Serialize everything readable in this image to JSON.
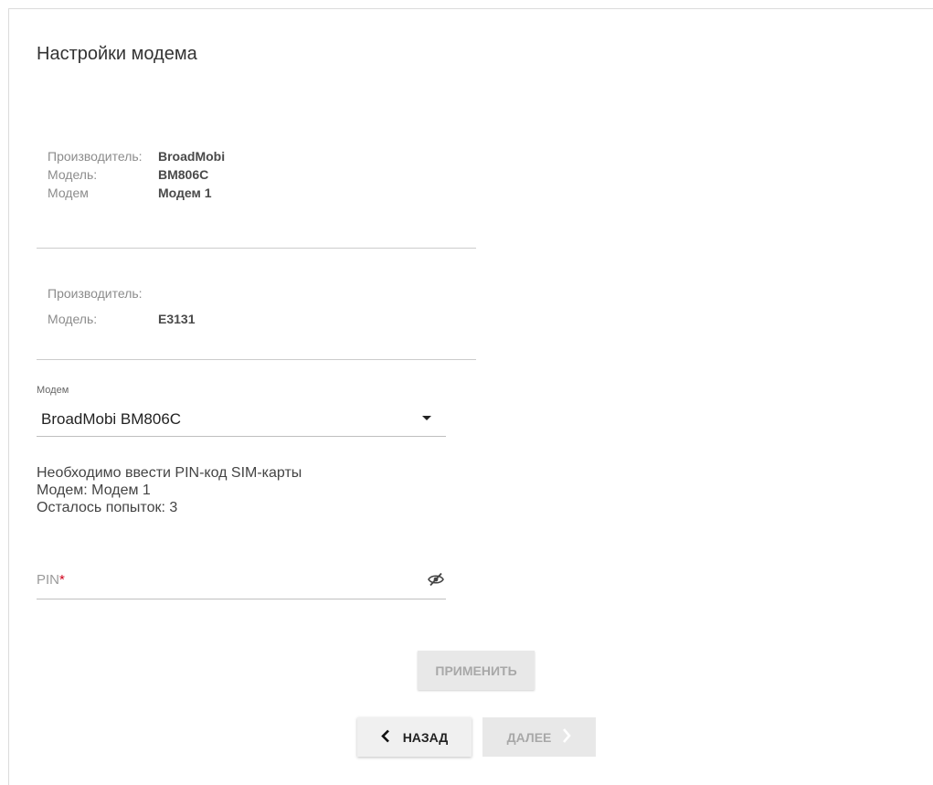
{
  "page": {
    "title": "Настройки модема"
  },
  "modem1": {
    "manufacturer_label": "Производитель:",
    "manufacturer_value": "BroadMobi",
    "model_label": "Модель:",
    "model_value": "BM806C",
    "modem_label": "Модем",
    "modem_value": "Модем 1"
  },
  "modem2": {
    "manufacturer_label": "Производитель:",
    "manufacturer_value": "",
    "model_label": "Модель:",
    "model_value": "E3131"
  },
  "modem_select": {
    "label": "Модем",
    "selected": "BroadMobi BM806C"
  },
  "notice": {
    "line1": "Необходимо ввести PIN-код SIM-карты",
    "line2": "Модем: Модем 1",
    "line3": "Осталось попыток: 3"
  },
  "pin": {
    "label": "PIN",
    "required_mark": "*",
    "visibility_icon": "eye-off-icon"
  },
  "buttons": {
    "apply": "ПРИМЕНИТЬ",
    "back": "НАЗАД",
    "next": "ДАЛЕЕ"
  },
  "colors": {
    "required": "#d0021b",
    "disabled_text": "#a8a8a8"
  }
}
